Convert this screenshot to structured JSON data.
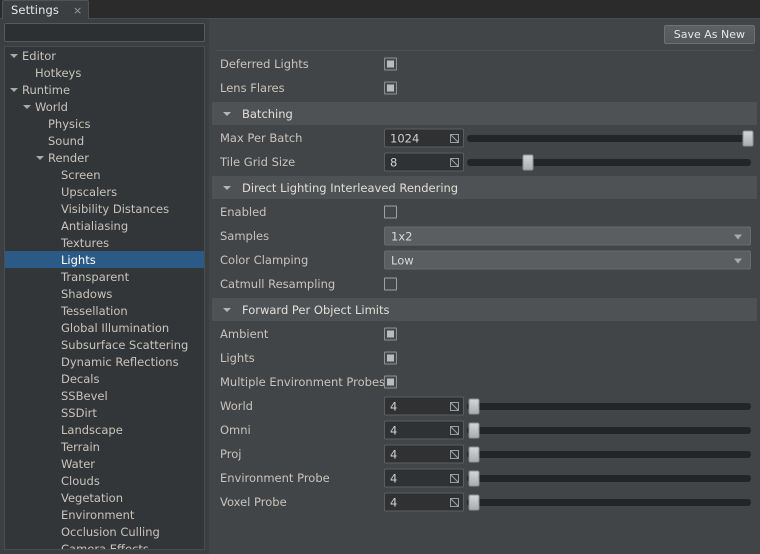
{
  "tab": {
    "label": "Settings",
    "close_icon": "×"
  },
  "search": {
    "value": "",
    "placeholder": ""
  },
  "sidebar": {
    "items": [
      {
        "label": "Editor",
        "depth": 0,
        "expanded": true,
        "selected": false
      },
      {
        "label": "Hotkeys",
        "depth": 1,
        "expanded": null,
        "selected": false
      },
      {
        "label": "Runtime",
        "depth": 0,
        "expanded": true,
        "selected": false
      },
      {
        "label": "World",
        "depth": 1,
        "expanded": true,
        "selected": false
      },
      {
        "label": "Physics",
        "depth": 2,
        "expanded": null,
        "selected": false
      },
      {
        "label": "Sound",
        "depth": 2,
        "expanded": null,
        "selected": false
      },
      {
        "label": "Render",
        "depth": 2,
        "expanded": true,
        "selected": false
      },
      {
        "label": "Screen",
        "depth": 3,
        "expanded": null,
        "selected": false
      },
      {
        "label": "Upscalers",
        "depth": 3,
        "expanded": null,
        "selected": false
      },
      {
        "label": "Visibility Distances",
        "depth": 3,
        "expanded": null,
        "selected": false
      },
      {
        "label": "Antialiasing",
        "depth": 3,
        "expanded": null,
        "selected": false
      },
      {
        "label": "Textures",
        "depth": 3,
        "expanded": null,
        "selected": false
      },
      {
        "label": "Lights",
        "depth": 3,
        "expanded": null,
        "selected": true
      },
      {
        "label": "Transparent",
        "depth": 3,
        "expanded": null,
        "selected": false
      },
      {
        "label": "Shadows",
        "depth": 3,
        "expanded": null,
        "selected": false
      },
      {
        "label": "Tessellation",
        "depth": 3,
        "expanded": null,
        "selected": false
      },
      {
        "label": "Global Illumination",
        "depth": 3,
        "expanded": null,
        "selected": false
      },
      {
        "label": "Subsurface Scattering",
        "depth": 3,
        "expanded": null,
        "selected": false
      },
      {
        "label": "Dynamic Reflections",
        "depth": 3,
        "expanded": null,
        "selected": false
      },
      {
        "label": "Decals",
        "depth": 3,
        "expanded": null,
        "selected": false
      },
      {
        "label": "SSBevel",
        "depth": 3,
        "expanded": null,
        "selected": false
      },
      {
        "label": "SSDirt",
        "depth": 3,
        "expanded": null,
        "selected": false
      },
      {
        "label": "Landscape",
        "depth": 3,
        "expanded": null,
        "selected": false
      },
      {
        "label": "Terrain",
        "depth": 3,
        "expanded": null,
        "selected": false
      },
      {
        "label": "Water",
        "depth": 3,
        "expanded": null,
        "selected": false
      },
      {
        "label": "Clouds",
        "depth": 3,
        "expanded": null,
        "selected": false
      },
      {
        "label": "Vegetation",
        "depth": 3,
        "expanded": null,
        "selected": false
      },
      {
        "label": "Environment",
        "depth": 3,
        "expanded": null,
        "selected": false
      },
      {
        "label": "Occlusion Culling",
        "depth": 3,
        "expanded": null,
        "selected": false
      },
      {
        "label": "Camera Effects",
        "depth": 3,
        "expanded": null,
        "selected": false
      }
    ]
  },
  "toolbar": {
    "save_as_new_label": "Save As New"
  },
  "panel": {
    "rows": [
      {
        "kind": "checkbox",
        "label": "Deferred Lights",
        "checked": true
      },
      {
        "kind": "checkbox",
        "label": "Lens Flares",
        "checked": true
      },
      {
        "kind": "section",
        "label": "Batching",
        "expanded": true
      },
      {
        "kind": "spinslider",
        "label": "Max Per Batch",
        "value": "1024",
        "fill": 99.0
      },
      {
        "kind": "spinslider",
        "label": "Tile Grid Size",
        "value": "8",
        "fill": 21.5
      },
      {
        "kind": "section",
        "label": "Direct Lighting Interleaved Rendering",
        "expanded": true
      },
      {
        "kind": "checkbox",
        "label": "Enabled",
        "checked": false
      },
      {
        "kind": "dropdown",
        "label": "Samples",
        "value": "1x2"
      },
      {
        "kind": "dropdown",
        "label": "Color Clamping",
        "value": "Low"
      },
      {
        "kind": "checkbox",
        "label": "Catmull Resampling",
        "checked": false
      },
      {
        "kind": "section",
        "label": "Forward Per Object Limits",
        "expanded": true
      },
      {
        "kind": "checkbox",
        "label": "Ambient",
        "checked": true
      },
      {
        "kind": "checkbox",
        "label": "Lights",
        "checked": true
      },
      {
        "kind": "checkbox",
        "label": "Multiple Environment Probes",
        "checked": true
      },
      {
        "kind": "spinslider",
        "label": "World",
        "value": "4",
        "fill": 2.5
      },
      {
        "kind": "spinslider",
        "label": "Omni",
        "value": "4",
        "fill": 2.5
      },
      {
        "kind": "spinslider",
        "label": "Proj",
        "value": "4",
        "fill": 2.5
      },
      {
        "kind": "spinslider",
        "label": "Environment Probe",
        "value": "4",
        "fill": 2.5
      },
      {
        "kind": "spinslider",
        "label": "Voxel Probe",
        "value": "4",
        "fill": 2.5
      }
    ]
  },
  "colors": {
    "window_bg": "#3c3f41",
    "panel_bg": "#424548",
    "tree_bg": "#333638",
    "selection": "#2a5a85",
    "section_header": "#4e5255",
    "text": "#c9c3bb"
  }
}
